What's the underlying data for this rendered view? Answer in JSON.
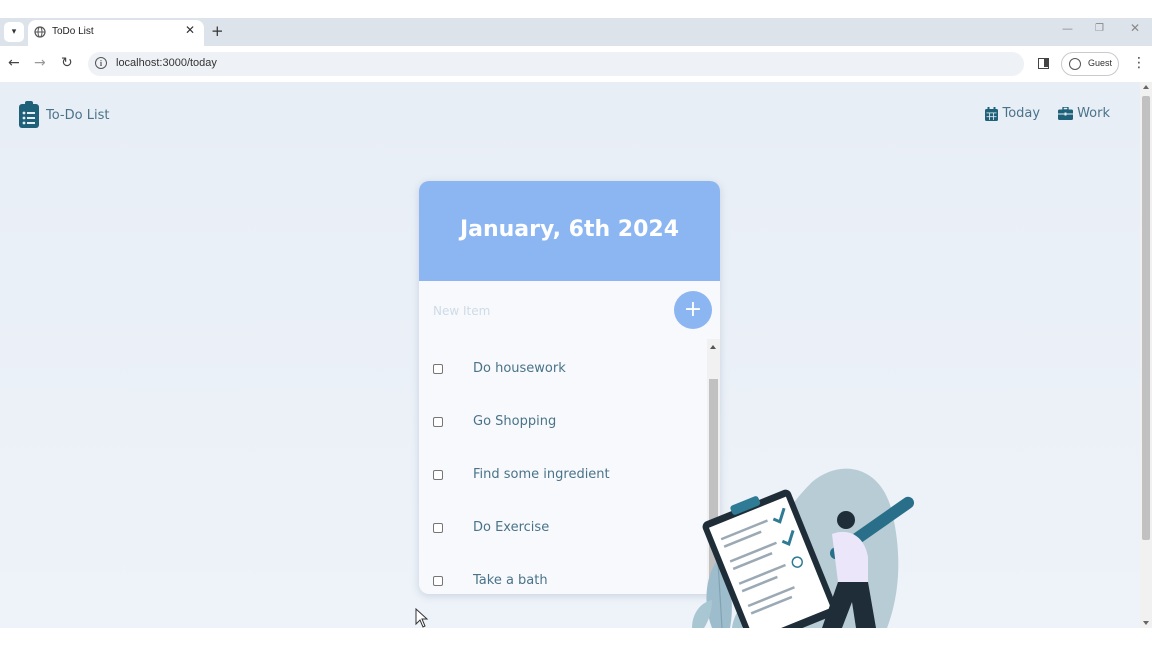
{
  "browser": {
    "tab_title": "ToDo List",
    "url": "localhost:3000/today",
    "profile_label": "Guest"
  },
  "app": {
    "brand": "To-Do List",
    "nav": [
      {
        "label": "Today",
        "icon": "calendar-icon"
      },
      {
        "label": "Work",
        "icon": "briefcase-icon"
      }
    ],
    "date_heading": "January, 6th 2024",
    "new_item_placeholder": "New Item",
    "add_button_label": "+",
    "items": [
      {
        "label": "Do housework",
        "checked": false
      },
      {
        "label": "Go Shopping",
        "checked": false
      },
      {
        "label": "Find some ingredient",
        "checked": false
      },
      {
        "label": "Do Exercise",
        "checked": false
      },
      {
        "label": "Take a bath",
        "checked": false
      }
    ]
  },
  "colors": {
    "accent": "#8cb6f2",
    "text": "#4a7389",
    "icon_dark": "#1e6178"
  }
}
